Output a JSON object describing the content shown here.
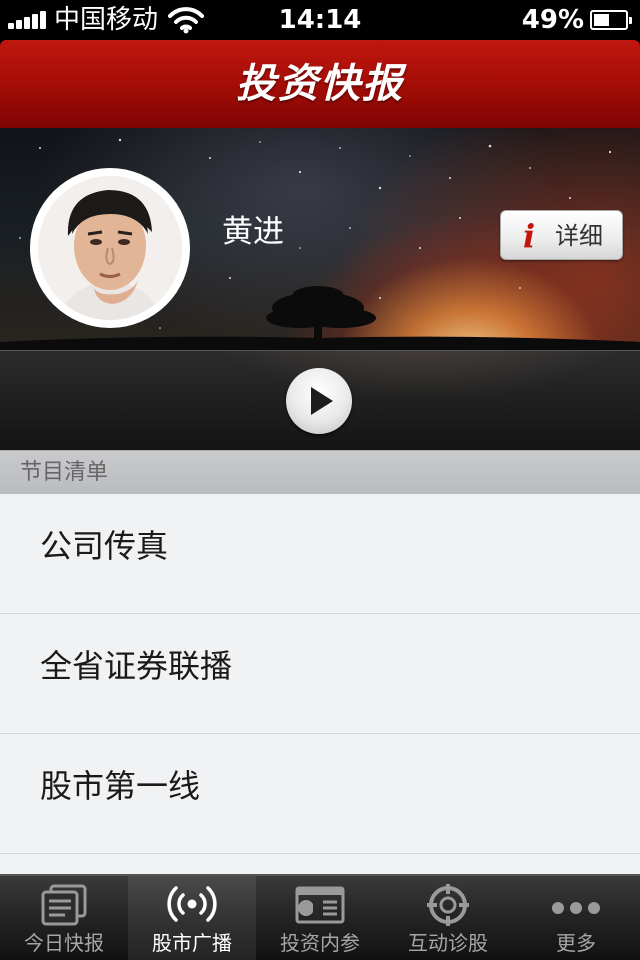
{
  "status_bar": {
    "carrier": "中国移动",
    "time": "14:14",
    "battery_percent_text": "49%",
    "battery_level": 0.49
  },
  "header": {
    "title": "投资快报"
  },
  "host": {
    "name": "黄进",
    "detail_button_label": "详细",
    "detail_icon_glyph": "i"
  },
  "section": {
    "title": "节目清单"
  },
  "programs": [
    {
      "label": "公司传真"
    },
    {
      "label": "全省证券联播"
    },
    {
      "label": "股市第一线"
    }
  ],
  "tabbar": {
    "items": [
      {
        "label": "今日快报",
        "icon": "news-stack-icon",
        "active": false
      },
      {
        "label": "股市广播",
        "icon": "broadcast-icon",
        "active": true
      },
      {
        "label": "投资内参",
        "icon": "report-icon",
        "active": false
      },
      {
        "label": "互动诊股",
        "icon": "target-icon",
        "active": false
      },
      {
        "label": "更多",
        "icon": "more-dots-icon",
        "active": false
      }
    ]
  },
  "colors": {
    "header_red": "#b3100a",
    "detail_icon_red": "#c4150d",
    "list_background": "#f1f2f4",
    "section_header_gray": "#c1c2c4",
    "tab_active_text": "#ffffff",
    "tab_inactive_text": "#a6a6a6"
  }
}
